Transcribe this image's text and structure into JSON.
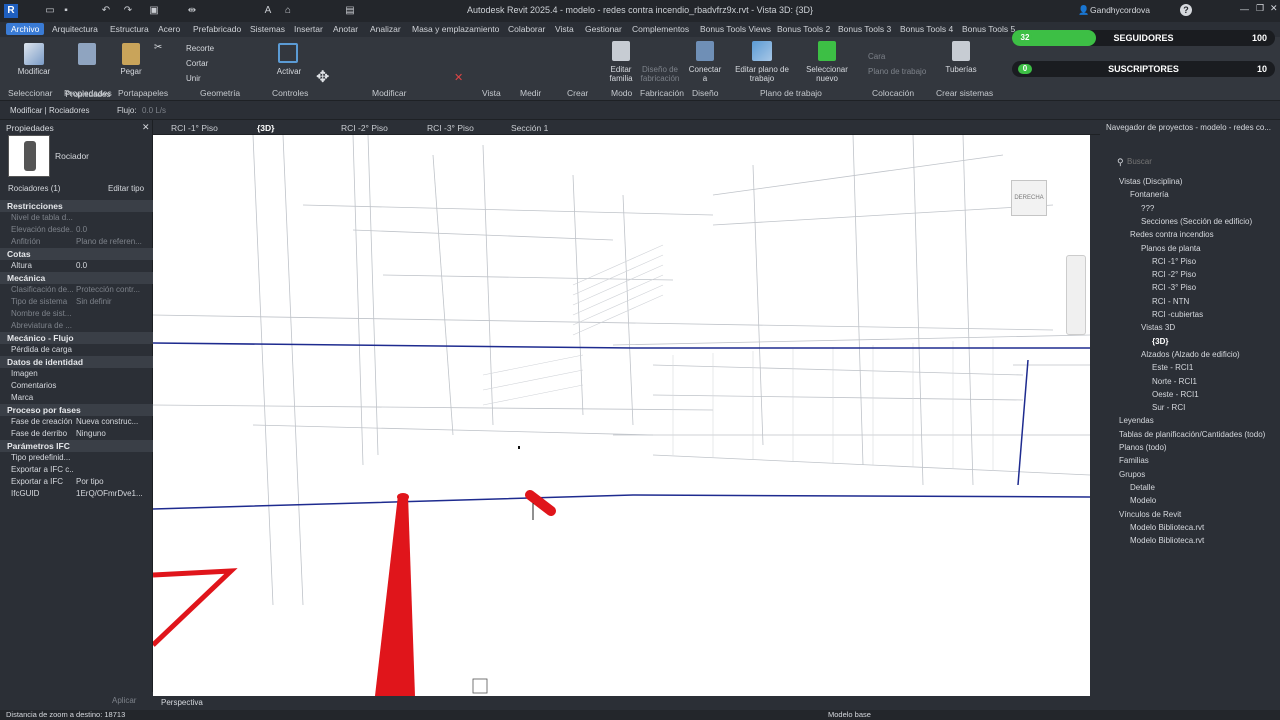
{
  "app": {
    "title": "Autodesk Revit 2025.4 - modelo - redes contra incendio_rbadvfrz9x.rvt - Vista 3D: {3D}",
    "user": "Gandhycordova",
    "help": "?"
  },
  "ribbon_tabs": [
    "Archivo",
    "Arquitectura",
    "Estructura",
    "Acero",
    "Prefabricado",
    "Sistemas",
    "Insertar",
    "Anotar",
    "Analizar",
    "Masa y emplazamiento",
    "Colaborar",
    "Vista",
    "Gestionar",
    "Complementos",
    "Bonus Tools Views",
    "Bonus Tools 2",
    "Bonus Tools 3",
    "Bonus Tools 4",
    "Bonus Tools 5"
  ],
  "ribbon": {
    "modificar": "Modificar",
    "propiedades": "Propiedades",
    "pegar": "Pegar",
    "recorte": "Recorte",
    "cortar": "Cortar",
    "unir": "Unir",
    "activar": "Activar",
    "editar_familia": "Editar familia",
    "diseno_fab": "Diseño de fabricación",
    "conectar": "Conectar a",
    "editar_plano": "Editar plano de trabajo",
    "seleccionar_nuevo": "Seleccionar nuevo",
    "cara": "Cara",
    "plano_trabajo": "Plano de trabajo",
    "tuberias": "Tuberías",
    "groups": [
      "Seleccionar",
      "Propiedades",
      "Portapapeles",
      "Geometría",
      "Controles",
      "Modificar",
      "Vista",
      "Medir",
      "Crear",
      "Modo",
      "Fabricación",
      "Diseño",
      "Plano de trabajo",
      "Colocación",
      "Crear sistemas"
    ]
  },
  "social": {
    "seguidores_label": "SEGUIDORES",
    "seguidores_current": "32",
    "seguidores_target": "100",
    "seguidores_progress": 0.32,
    "suscriptores_label": "SUSCRIPTORES",
    "suscriptores_current": "0",
    "suscriptores_target": "10",
    "suscriptores_progress": 0.0
  },
  "optbar": {
    "context": "Modificar | Rociadores",
    "flujo_label": "Flujo:",
    "flujo_value": "0.0 L/s"
  },
  "properties": {
    "title": "Propiedades",
    "family": "Rociador",
    "selector": "Rociadores (1)",
    "edit_type": "Editar tipo",
    "sections": [
      {
        "name": "Restricciones",
        "rows": [
          [
            "Nivel de tabla d...",
            ""
          ],
          [
            "Elevación desde...",
            "0.0"
          ],
          [
            "Anfitrión",
            "Plano de referen..."
          ]
        ]
      },
      {
        "name": "Cotas",
        "rows": [
          [
            "Altura",
            "0.0"
          ]
        ]
      },
      {
        "name": "Mecánica",
        "rows": [
          [
            "Clasificación de...",
            "Protección contr..."
          ],
          [
            "Tipo de sistema",
            "Sin definir"
          ],
          [
            "Nombre de sist...",
            ""
          ],
          [
            "Abreviatura de ...",
            ""
          ]
        ]
      },
      {
        "name": "Mecánico - Flujo",
        "rows": [
          [
            "Pérdida de carga",
            ""
          ]
        ]
      },
      {
        "name": "Datos de identidad",
        "rows": [
          [
            "Imagen",
            ""
          ],
          [
            "Comentarios",
            ""
          ],
          [
            "Marca",
            ""
          ]
        ]
      },
      {
        "name": "Proceso por fases",
        "rows": [
          [
            "Fase de creación",
            "Nueva construc..."
          ],
          [
            "Fase de derribo",
            "Ninguno"
          ]
        ]
      },
      {
        "name": "Parámetros IFC",
        "rows": [
          [
            "Tipo predefinid...",
            ""
          ],
          [
            "Exportar a IFC c...",
            ""
          ],
          [
            "Exportar a IFC",
            "Por tipo"
          ],
          [
            "IfcGUID",
            "1ErQ/OFmrDve1..."
          ]
        ]
      }
    ],
    "apply": "Aplicar"
  },
  "view_tabs": [
    "RCI -1° Piso",
    "{3D}",
    "RCI -2° Piso",
    "RCI -3° Piso",
    "Sección 1"
  ],
  "viewcube": {
    "face": "DERECHA"
  },
  "view_control": {
    "mode": "Perspectiva"
  },
  "browser": {
    "title": "Navegador de proyectos - modelo - redes co...",
    "search_placeholder": "Buscar",
    "nodes": [
      {
        "t": "Vistas (Disciplina)",
        "l": 0
      },
      {
        "t": "Fontanería",
        "l": 1
      },
      {
        "t": "???",
        "l": 2
      },
      {
        "t": "Secciones (Sección de edificio)",
        "l": 2
      },
      {
        "t": "Redes contra incendios",
        "l": 1
      },
      {
        "t": "Planos de planta",
        "l": 2
      },
      {
        "t": "RCI -1° Piso",
        "l": 3
      },
      {
        "t": "RCI -2° Piso",
        "l": 3
      },
      {
        "t": "RCI -3° Piso",
        "l": 3
      },
      {
        "t": "RCI - NTN",
        "l": 3
      },
      {
        "t": "RCI -cubiertas",
        "l": 3
      },
      {
        "t": "Vistas 3D",
        "l": 2
      },
      {
        "t": "{3D}",
        "l": 3
      },
      {
        "t": "Alzados (Alzado de edificio)",
        "l": 2
      },
      {
        "t": "Este - RCI1",
        "l": 3
      },
      {
        "t": "Norte - RCI1",
        "l": 3
      },
      {
        "t": "Oeste - RCI1",
        "l": 3
      },
      {
        "t": "Sur - RCI",
        "l": 3
      },
      {
        "t": "Leyendas",
        "l": 0
      },
      {
        "t": "Tablas de planificación/Cantidades (todo)",
        "l": 0
      },
      {
        "t": "Planos (todo)",
        "l": 0
      },
      {
        "t": "Familias",
        "l": 0
      },
      {
        "t": "Grupos",
        "l": 0
      },
      {
        "t": "Detalle",
        "l": 1
      },
      {
        "t": "Modelo",
        "l": 1
      },
      {
        "t": "Vínculos de Revit",
        "l": 0
      },
      {
        "t": "Modelo Biblioteca.rvt",
        "l": 1
      },
      {
        "t": "Modelo Biblioteca.rvt",
        "l": 1
      }
    ]
  },
  "status": {
    "left": "Distancia de zoom a destino: 18713",
    "model": "Modelo base"
  }
}
